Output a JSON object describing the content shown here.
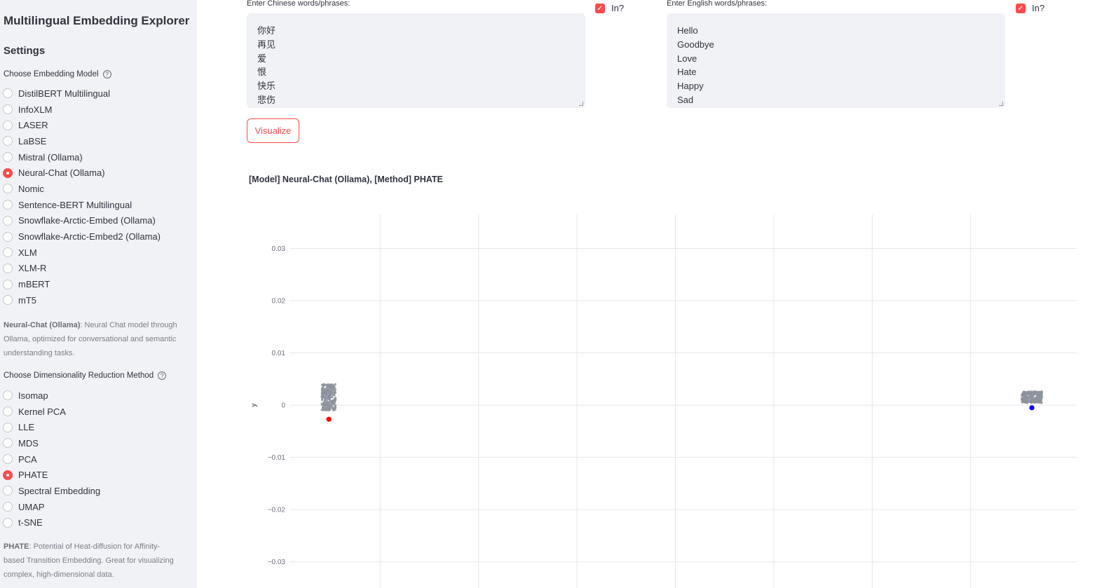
{
  "sidebar": {
    "app_title": "Multilingual Embedding Explorer",
    "settings_title": "Settings",
    "model_group_label": "Choose Embedding Model",
    "models": [
      {
        "label": "DistilBERT Multilingual",
        "selected": false
      },
      {
        "label": "InfoXLM",
        "selected": false
      },
      {
        "label": "LASER",
        "selected": false
      },
      {
        "label": "LaBSE",
        "selected": false
      },
      {
        "label": "Mistral (Ollama)",
        "selected": false
      },
      {
        "label": "Neural-Chat (Ollama)",
        "selected": true
      },
      {
        "label": "Nomic",
        "selected": false
      },
      {
        "label": "Sentence-BERT Multilingual",
        "selected": false
      },
      {
        "label": "Snowflake-Arctic-Embed (Ollama)",
        "selected": false
      },
      {
        "label": "Snowflake-Arctic-Embed2 (Ollama)",
        "selected": false
      },
      {
        "label": "XLM",
        "selected": false
      },
      {
        "label": "XLM-R",
        "selected": false
      },
      {
        "label": "mBERT",
        "selected": false
      },
      {
        "label": "mT5",
        "selected": false
      }
    ],
    "model_desc_name": "Neural-Chat (Ollama)",
    "model_desc_text": ": Neural Chat model through Ollama, optimized for conversational and semantic understanding tasks.",
    "method_group_label": "Choose Dimensionality Reduction Method",
    "methods": [
      {
        "label": "Isomap",
        "selected": false
      },
      {
        "label": "Kernel PCA",
        "selected": false
      },
      {
        "label": "LLE",
        "selected": false
      },
      {
        "label": "MDS",
        "selected": false
      },
      {
        "label": "PCA",
        "selected": false
      },
      {
        "label": "PHATE",
        "selected": true
      },
      {
        "label": "Spectral Embedding",
        "selected": false
      },
      {
        "label": "UMAP",
        "selected": false
      },
      {
        "label": "t-SNE",
        "selected": false
      }
    ],
    "method_desc_name": "PHATE",
    "method_desc_text": ": Potential of Heat-diffusion for Affinity-based Transition Embedding. Great for visualizing complex, high-dimensional data.",
    "help_icon": "?"
  },
  "main": {
    "chinese_label": "Enter Chinese words/phrases:",
    "chinese_value": "你好\n再见\n爱\n恨\n快乐\n悲伤",
    "chinese_checkbox_label": "In?",
    "english_label": "Enter English words/phrases:",
    "english_value": "Hello\nGoodbye\nLove\nHate\nHappy\nSad",
    "english_checkbox_label": "In?",
    "checkmark": "✓",
    "visualize_label": "Visualize",
    "chart_title": "[Model] Neural-Chat (Ollama), [Method] PHATE"
  },
  "colors": {
    "accent": "#ff4b4b",
    "sidebar_bg": "#f0f2f6",
    "chinese_points": "#ff0000",
    "english_points": "#0000ff",
    "cloud_points": "#8d939c"
  },
  "chart_data": {
    "type": "scatter",
    "title": "",
    "xlabel": "",
    "ylabel": "y",
    "ylim": [
      -0.035,
      0.0365
    ],
    "yticks": [
      0.03,
      0.02,
      0.01,
      0,
      -0.01,
      -0.02,
      -0.03
    ],
    "ytick_labels": [
      "0.03",
      "0.02",
      "0.01",
      "0",
      "−0.01",
      "−0.02",
      "−0.03"
    ],
    "xlim": [
      0,
      1
    ],
    "grid": true,
    "series": [
      {
        "color": "#ff0000",
        "points": [
          [
            0.05,
            -0.0027
          ]
        ]
      },
      {
        "color": "#0000ff",
        "points": [
          [
            0.943,
            -0.0005
          ]
        ]
      }
    ],
    "clouds": [
      {
        "color": "#8d939c",
        "center": [
          0.05,
          0.0015
        ],
        "spread": [
          0.009,
          0.0025
        ]
      },
      {
        "color": "#8d939c",
        "center": [
          0.943,
          0.0015
        ],
        "spread": [
          0.013,
          0.0011
        ]
      }
    ]
  }
}
